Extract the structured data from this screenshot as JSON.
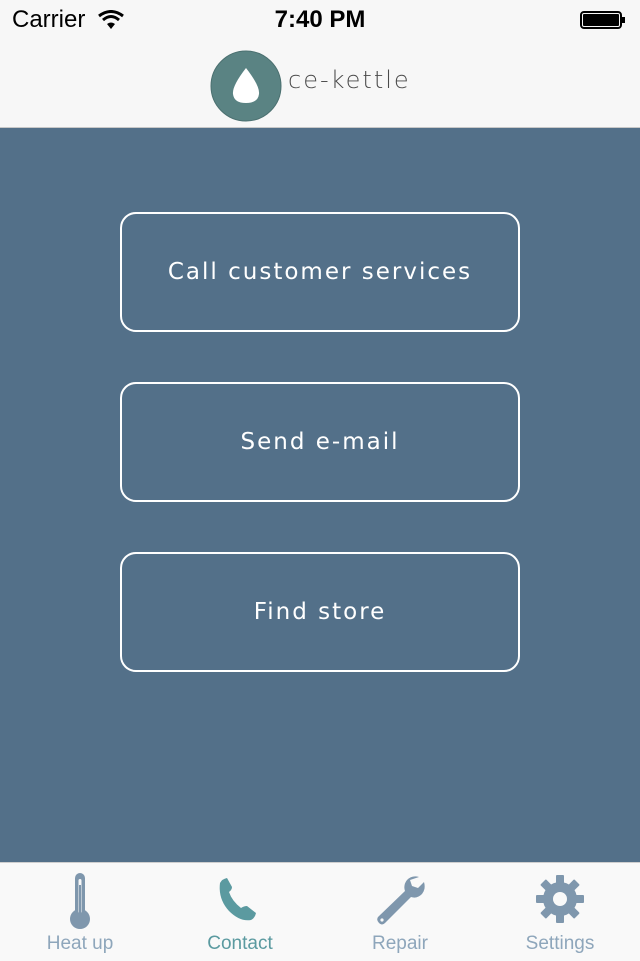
{
  "status_bar": {
    "carrier": "Carrier",
    "time": "7:40 PM"
  },
  "header": {
    "brand": "ce-kettle",
    "logo_icon": "water-drop-icon"
  },
  "actions": [
    {
      "label": "Call customer services"
    },
    {
      "label": "Send e-mail"
    },
    {
      "label": "Find store"
    }
  ],
  "tab_bar": {
    "active_tab": "Contact",
    "tabs": [
      {
        "label": "Heat up",
        "icon": "thermometer-icon"
      },
      {
        "label": "Contact",
        "icon": "phone-icon"
      },
      {
        "label": "Repair",
        "icon": "wrench-icon"
      },
      {
        "label": "Settings",
        "icon": "gear-icon"
      }
    ]
  },
  "colors": {
    "background": "#537089",
    "accent_active": "#5b9aa0",
    "inactive_label": "#8ea6bb",
    "inactive_icon": "#7f97ad",
    "logo": "#5a8383"
  }
}
